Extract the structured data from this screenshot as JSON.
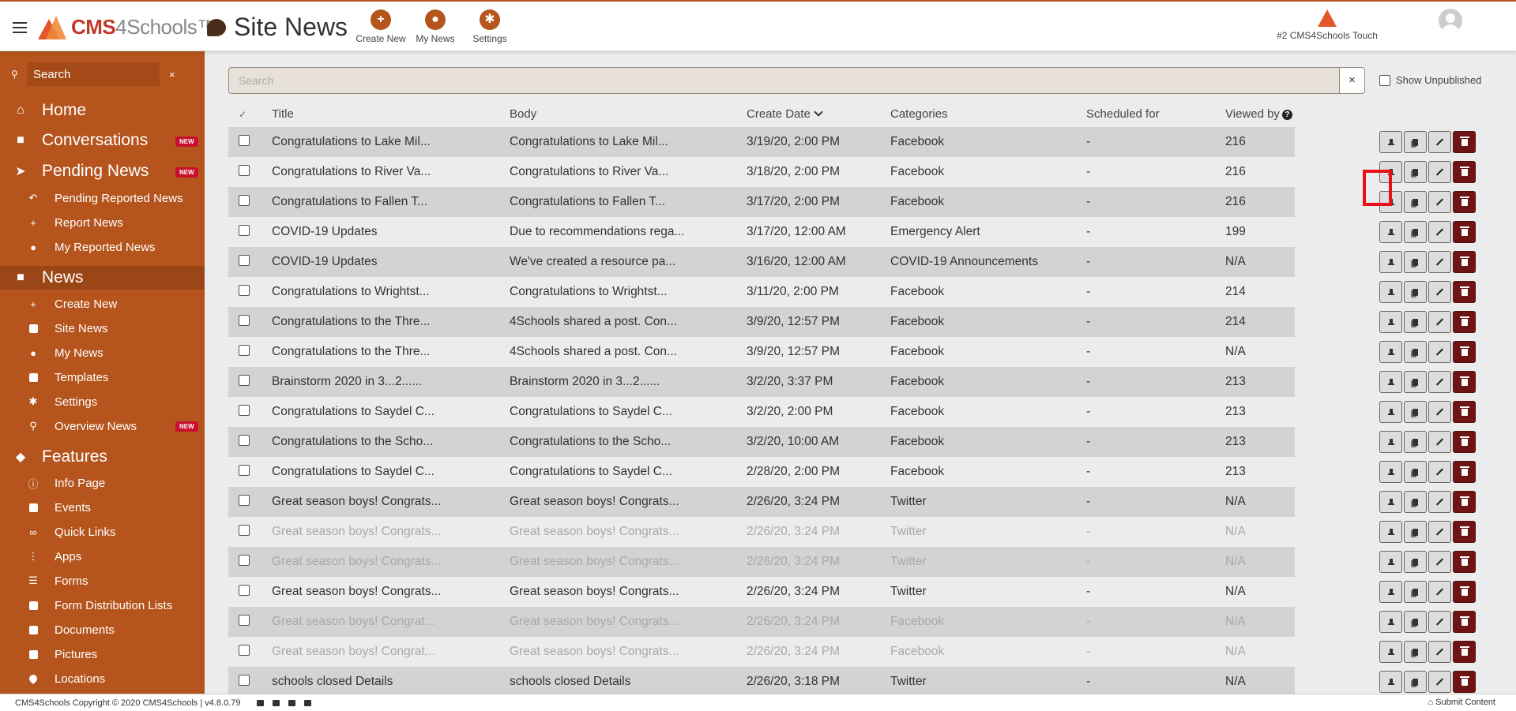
{
  "app": {
    "brand_left": "CMS",
    "brand_mid": "4Schools",
    "brand_tm": "™",
    "page_title": "Site News"
  },
  "top_actions": [
    {
      "label": "Create New",
      "glyph": "+"
    },
    {
      "label": "My News",
      "glyph": "●"
    },
    {
      "label": "Settings",
      "glyph": "✱"
    }
  ],
  "site_switch": {
    "label": "#2 CMS4Schools Touch"
  },
  "sidebar": {
    "search_placeholder": "Search",
    "clear": "×",
    "home": "Home",
    "conversations": "Conversations",
    "pending_news": "Pending News",
    "pending_reported": "Pending Reported News",
    "report_news": "Report News",
    "my_reported": "My Reported News",
    "news": "News",
    "create_new": "Create New",
    "site_news": "Site News",
    "my_news": "My News",
    "templates": "Templates",
    "settings": "Settings",
    "overview_news": "Overview News",
    "features": "Features",
    "info_page": "Info Page",
    "events": "Events",
    "quick_links": "Quick Links",
    "apps": "Apps",
    "forms": "Forms",
    "form_distribution": "Form Distribution Lists",
    "documents": "Documents",
    "pictures": "Pictures",
    "locations": "Locations",
    "new_badge": "NEW"
  },
  "toolbar": {
    "search_placeholder": "Search",
    "clear": "×",
    "show_unpublished": "Show Unpublished"
  },
  "table": {
    "headers": {
      "check": "✓",
      "title": "Title",
      "body": "Body",
      "create_date": "Create Date",
      "categories": "Categories",
      "scheduled": "Scheduled for",
      "viewed": "Viewed by",
      "help": "?"
    },
    "rows": [
      {
        "title": "Congratulations to Lake Mil...",
        "body": "Congratulations to Lake Mil...",
        "date": "3/19/20, 2:00 PM",
        "category": "Facebook",
        "scheduled": "-",
        "viewed": "216",
        "faded": false
      },
      {
        "title": "Congratulations to River Va...",
        "body": "Congratulations to River Va...",
        "date": "3/18/20, 2:00 PM",
        "category": "Facebook",
        "scheduled": "-",
        "viewed": "216",
        "faded": false
      },
      {
        "title": "Congratulations to Fallen T...",
        "body": "Congratulations to Fallen T...",
        "date": "3/17/20, 2:00 PM",
        "category": "Facebook",
        "scheduled": "-",
        "viewed": "216",
        "faded": false
      },
      {
        "title": "COVID-19 Updates",
        "body": "Due to recommendations rega...",
        "date": "3/17/20, 12:00 AM",
        "category": "Emergency Alert",
        "scheduled": "-",
        "viewed": "199",
        "faded": false
      },
      {
        "title": "COVID-19 Updates",
        "body": "We've created a resource pa...",
        "date": "3/16/20, 12:00 AM",
        "category": "COVID-19 Announcements",
        "scheduled": "-",
        "viewed": "N/A",
        "faded": false
      },
      {
        "title": "Congratulations to Wrightst...",
        "body": "Congratulations to Wrightst...",
        "date": "3/11/20, 2:00 PM",
        "category": "Facebook",
        "scheduled": "-",
        "viewed": "214",
        "faded": false
      },
      {
        "title": "Congratulations to the Thre...",
        "body": "4Schools shared a post. Con...",
        "date": "3/9/20, 12:57 PM",
        "category": "Facebook",
        "scheduled": "-",
        "viewed": "214",
        "faded": false
      },
      {
        "title": "Congratulations to the Thre...",
        "body": "4Schools shared a post. Con...",
        "date": "3/9/20, 12:57 PM",
        "category": "Facebook",
        "scheduled": "-",
        "viewed": "N/A",
        "faded": false
      },
      {
        "title": "Brainstorm 2020 in 3...2......",
        "body": "Brainstorm 2020 in 3...2......",
        "date": "3/2/20, 3:37 PM",
        "category": "Facebook",
        "scheduled": "-",
        "viewed": "213",
        "faded": false
      },
      {
        "title": "Congratulations to Saydel C...",
        "body": "Congratulations to Saydel C...",
        "date": "3/2/20, 2:00 PM",
        "category": "Facebook",
        "scheduled": "-",
        "viewed": "213",
        "faded": false
      },
      {
        "title": "Congratulations to the Scho...",
        "body": "Congratulations to the Scho...",
        "date": "3/2/20, 10:00 AM",
        "category": "Facebook",
        "scheduled": "-",
        "viewed": "213",
        "faded": false
      },
      {
        "title": "Congratulations to Saydel C...",
        "body": "Congratulations to Saydel C...",
        "date": "2/28/20, 2:00 PM",
        "category": "Facebook",
        "scheduled": "-",
        "viewed": "213",
        "faded": false
      },
      {
        "title": "Great season boys! Congrats...",
        "body": "Great season boys! Congrats...",
        "date": "2/26/20, 3:24 PM",
        "category": "Twitter",
        "scheduled": "-",
        "viewed": "N/A",
        "faded": false
      },
      {
        "title": "Great season boys! Congrats...",
        "body": "Great season boys! Congrats...",
        "date": "2/26/20, 3:24 PM",
        "category": "Twitter",
        "scheduled": "-",
        "viewed": "N/A",
        "faded": true
      },
      {
        "title": "Great season boys! Congrats...",
        "body": "Great season boys! Congrats...",
        "date": "2/26/20, 3:24 PM",
        "category": "Twitter",
        "scheduled": "-",
        "viewed": "N/A",
        "faded": true
      },
      {
        "title": "Great season boys! Congrats...",
        "body": "Great season boys! Congrats...",
        "date": "2/26/20, 3:24 PM",
        "category": "Twitter",
        "scheduled": "-",
        "viewed": "N/A",
        "faded": false
      },
      {
        "title": "Great season boys! Congrat...",
        "body": "Great season boys! Congrats...",
        "date": "2/26/20, 3:24 PM",
        "category": "Facebook",
        "scheduled": "-",
        "viewed": "N/A",
        "faded": true
      },
      {
        "title": "Great season boys! Congrat...",
        "body": "Great season boys! Congrats...",
        "date": "2/26/20, 3:24 PM",
        "category": "Facebook",
        "scheduled": "-",
        "viewed": "N/A",
        "faded": true
      },
      {
        "title": "schools closed Details",
        "body": "schools closed Details",
        "date": "2/26/20, 3:18 PM",
        "category": "Twitter",
        "scheduled": "-",
        "viewed": "N/A",
        "faded": false
      }
    ]
  },
  "footer": {
    "copyright": "CMS4Schools Copyright © 2020 CMS4Schools | v4.8.0.79",
    "submit": "Submit Content"
  },
  "colors": {
    "sidebar": "#b5541c",
    "delete_button": "#6e1414",
    "highlight": "#e8101a"
  }
}
